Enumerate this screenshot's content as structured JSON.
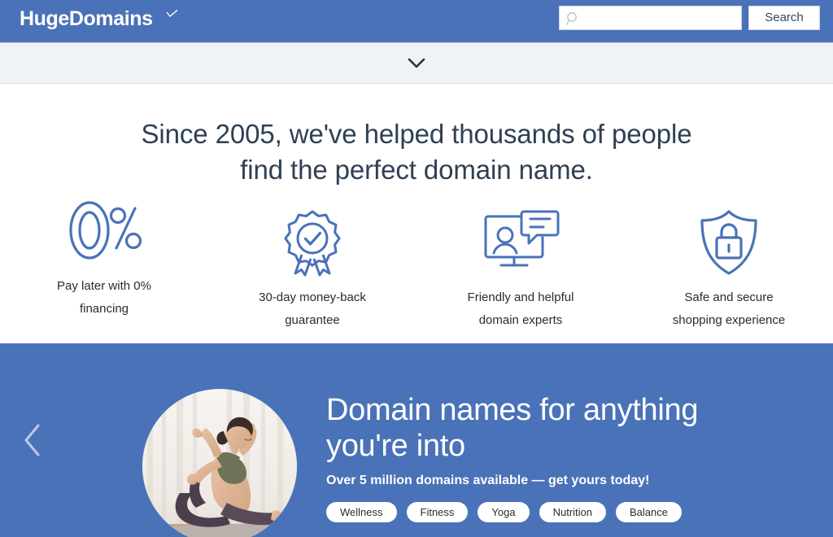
{
  "header": {
    "logo_text": "HugeDomains",
    "logo_icon": "checkmark-accent-icon",
    "search": {
      "value": "",
      "placeholder": "",
      "icon": "search-icon",
      "button_label": "Search"
    },
    "brand_color": "#4a72b8"
  },
  "collapse_bar": {
    "icon": "chevron-down-icon",
    "background_color": "#eff3f7"
  },
  "headline": {
    "line1": "Since 2005, we've helped thousands of people",
    "line2": "find the perfect domain name.",
    "color": "#2f4052"
  },
  "features": [
    {
      "icon": "zero-percent-icon",
      "label_line1": "Pay later with 0%",
      "label_line2": "financing"
    },
    {
      "icon": "award-ribbon-check-icon",
      "label_line1": "30-day money-back",
      "label_line2": "guarantee"
    },
    {
      "icon": "monitor-chat-support-icon",
      "label_line1": "Friendly and helpful",
      "label_line2": "domain experts"
    },
    {
      "icon": "shield-lock-icon",
      "label_line1": "Safe and secure",
      "label_line2": "shopping experience"
    }
  ],
  "hero": {
    "prev_icon": "chevron-left-icon",
    "photo_alt": "woman-yoga-pose-photo",
    "title": "Domain names for anything you're into",
    "subtitle": "Over 5 million domains available — get yours today!",
    "tags": [
      "Wellness",
      "Fitness",
      "Yoga",
      "Nutrition",
      "Balance"
    ],
    "background_color": "#4a72b8"
  },
  "accent_icon_color": "#4a72b8"
}
